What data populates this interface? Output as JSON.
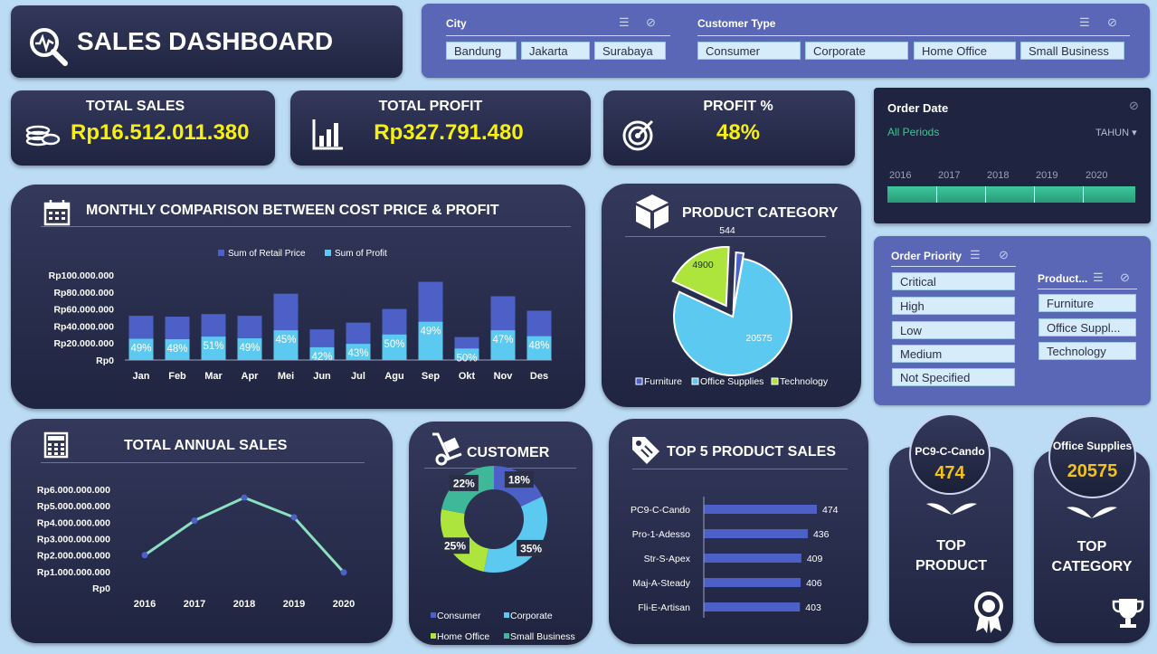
{
  "header": {
    "title": "SALES DASHBOARD",
    "icon": "search-chart-icon"
  },
  "city_slicer": {
    "title": "City",
    "items": [
      "Bandung",
      "Jakarta",
      "Surabaya"
    ]
  },
  "customer_type_slicer": {
    "title": "Customer Type",
    "items": [
      "Consumer",
      "Corporate",
      "Home Office",
      "Small Business"
    ]
  },
  "kpis": {
    "total_sales": {
      "title": "TOTAL SALES",
      "value": "Rp16.512.011.380",
      "icon": "coins-icon"
    },
    "total_profit": {
      "title": "TOTAL PROFIT",
      "value": "Rp327.791.480",
      "icon": "bar-chart-icon"
    },
    "profit_pct": {
      "title": "PROFIT %",
      "value": "48%",
      "icon": "target-icon"
    }
  },
  "order_date": {
    "title": "Order Date",
    "period": "All Periods",
    "level": "TAHUN",
    "years": [
      "2016",
      "2017",
      "2018",
      "2019",
      "2020"
    ]
  },
  "order_priority_slicer": {
    "title": "Order Priority",
    "items": [
      "Critical",
      "High",
      "Low",
      "Medium",
      "Not Specified"
    ]
  },
  "product_slicer": {
    "title": "Product...",
    "items": [
      "Furniture",
      "Office Suppl...",
      "Technology"
    ]
  },
  "monthly": {
    "title": "MONTHLY COMPARISON BETWEEN COST PRICE & PROFIT",
    "icon": "calendar-icon"
  },
  "product_category": {
    "title": "PRODUCT CATEGORY",
    "icon": "box-icon"
  },
  "annual": {
    "title": "TOTAL ANNUAL SALES",
    "icon": "calculator-icon"
  },
  "customer": {
    "title": "CUSTOMER",
    "icon": "hand-truck-icon"
  },
  "top5": {
    "title": "TOP 5 PRODUCT SALES",
    "icon": "tag-icon"
  },
  "top_product": {
    "name": "PC9-C-Cando",
    "value": "474",
    "label_1": "TOP",
    "label_2": "PRODUCT",
    "icon": "award-ribbon-icon"
  },
  "top_category": {
    "name": "Office Supplies",
    "value": "20575",
    "label_1": "TOP",
    "label_2": "CATEGORY",
    "icon": "trophy-icon"
  },
  "colors": {
    "retail": "#4d60c8",
    "profit": "#5bc9f0",
    "furniture": "#4d60c8",
    "office": "#5bc9f0",
    "technology": "#aee53d",
    "small_business": "#3fb89a",
    "line": "#8be0c0",
    "accent": "#f7ef12"
  },
  "chart_data": [
    {
      "type": "bar",
      "name": "monthly",
      "categories": [
        "Jan",
        "Feb",
        "Mar",
        "Apr",
        "Mei",
        "Jun",
        "Jul",
        "Agu",
        "Sep",
        "Okt",
        "Nov",
        "Des"
      ],
      "series": [
        {
          "name": "Sum of Retail Price",
          "values": [
            52000000,
            51000000,
            54000000,
            52000000,
            78000000,
            36000000,
            44000000,
            60000000,
            92000000,
            27000000,
            75000000,
            58000000
          ]
        },
        {
          "name": "Sum of Profit",
          "values": [
            25000000,
            24500000,
            27500000,
            25500000,
            35000000,
            15000000,
            19000000,
            30000000,
            45000000,
            13500000,
            35000000,
            28000000
          ]
        }
      ],
      "data_labels": [
        "49%",
        "48%",
        "51%",
        "49%",
        "45%",
        "42%",
        "43%",
        "50%",
        "49%",
        "50%",
        "47%",
        "48%"
      ],
      "yticks": [
        "Rp0",
        "Rp20.000.000",
        "Rp40.000.000",
        "Rp60.000.000",
        "Rp80.000.000",
        "Rp100.000.000"
      ],
      "ylim": [
        0,
        100000000
      ],
      "legend": "top"
    },
    {
      "type": "pie",
      "name": "product_category",
      "labels": [
        "Furniture",
        "Office Supplies",
        "Technology"
      ],
      "values": [
        544,
        20575,
        4900
      ],
      "legend": "bottom"
    },
    {
      "type": "line",
      "name": "annual",
      "x": [
        "2016",
        "2017",
        "2018",
        "2019",
        "2020"
      ],
      "values": [
        2000000000,
        4100000000,
        5500000000,
        4300000000,
        950000000
      ],
      "yticks": [
        "Rp0",
        "Rp1.000.000.000",
        "Rp2.000.000.000",
        "Rp3.000.000.000",
        "Rp4.000.000.000",
        "Rp5.000.000.000",
        "Rp6.000.000.000"
      ],
      "ylim": [
        0,
        6000000000
      ]
    },
    {
      "type": "pie",
      "name": "customer",
      "labels": [
        "Consumer",
        "Corporate",
        "Home Office",
        "Small Business"
      ],
      "values": [
        18,
        35,
        25,
        22
      ],
      "data_labels": [
        "18%",
        "35%",
        "25%",
        "22%"
      ],
      "legend": "bottom"
    },
    {
      "type": "bar",
      "name": "top5",
      "categories": [
        "PC9-C-Cando",
        "Pro-1-Adesso",
        "Str-S-Apex",
        "Maj-A-Steady",
        "Fli-E-Artisan"
      ],
      "values": [
        474,
        436,
        409,
        406,
        403
      ],
      "orientation": "horizontal"
    }
  ]
}
